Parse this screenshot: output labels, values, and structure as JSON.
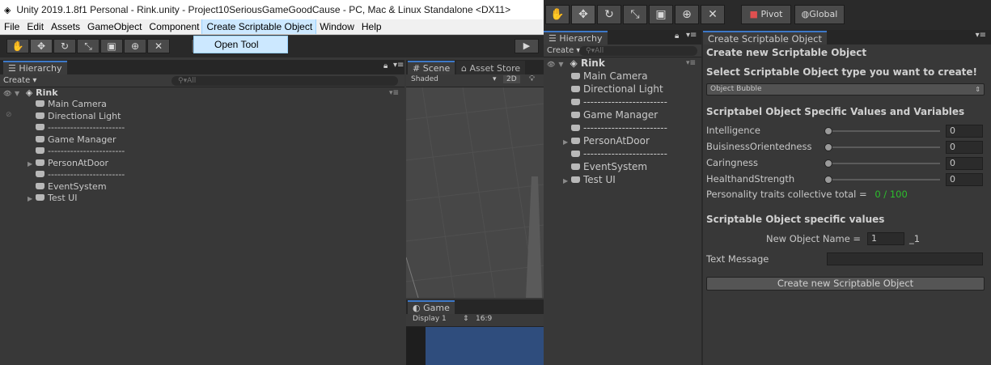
{
  "left_window": {
    "title": "Unity 2019.1.8f1 Personal - Rink.unity - Project10SeriousGameGoodCause - PC, Mac & Linux Standalone <DX11>",
    "menu": [
      "File",
      "Edit",
      "Assets",
      "GameObject",
      "Component",
      "Create Scriptable Object",
      "Window",
      "Help"
    ],
    "dropdown_item": "Open Tool",
    "hierarchy_tab": "Hierarchy",
    "scene_tab": "Scene",
    "asset_store_tab": "Asset Store",
    "create_label": "Create",
    "search_placeholder": "All",
    "shaded_label": "Shaded",
    "mode_2d": "2D",
    "scene_root": "Rink",
    "game_tab": "Game",
    "display_label": "Display 1",
    "aspect_label": "16:9"
  },
  "hierarchy_items": [
    {
      "label": "Main Camera",
      "expandable": false
    },
    {
      "label": "Directional Light",
      "expandable": false
    },
    {
      "label": "------------------------",
      "expandable": false
    },
    {
      "label": "Game Manager",
      "expandable": false
    },
    {
      "label": "------------------------",
      "expandable": false
    },
    {
      "label": "PersonAtDoor",
      "expandable": true
    },
    {
      "label": "------------------------",
      "expandable": false
    },
    {
      "label": "EventSystem",
      "expandable": false
    },
    {
      "label": "Test UI",
      "expandable": true
    }
  ],
  "right_window": {
    "pivot_label": "Pivot",
    "global_label": "Global",
    "hierarchy_tab": "Hierarchy",
    "create_label": "Create",
    "search_placeholder": "All",
    "scene_root": "Rink",
    "panel_tab": "Create Scriptable Object",
    "panel": {
      "heading": "Create new Scriptable Object",
      "select_label": "Select Scriptable Object type you want to create!",
      "selected_type": "Object Bubble",
      "specific_heading": "Scriptabel Object Specific Values and Variables",
      "traits": [
        {
          "label": "Intelligence",
          "value": "0"
        },
        {
          "label": "BuisinessOrientedness",
          "value": "0"
        },
        {
          "label": "Caringness",
          "value": "0"
        },
        {
          "label": "HealthandStrength",
          "value": "0"
        }
      ],
      "total_label": "Personality traits collective total =",
      "total_value": "0 / 100",
      "values_heading": "Scriptable Object specific values",
      "name_label": "New Object Name =",
      "name_value": "1",
      "name_suffix": "_1",
      "text_message_label": "Text Message",
      "text_message_value": "",
      "create_button": "Create new Scriptable Object"
    }
  },
  "colors": {
    "accent_blue": "#3d78c8",
    "total_green": "#2cbf2c",
    "menu_highlight": "#cce8ff",
    "panel_bg": "#383838"
  }
}
